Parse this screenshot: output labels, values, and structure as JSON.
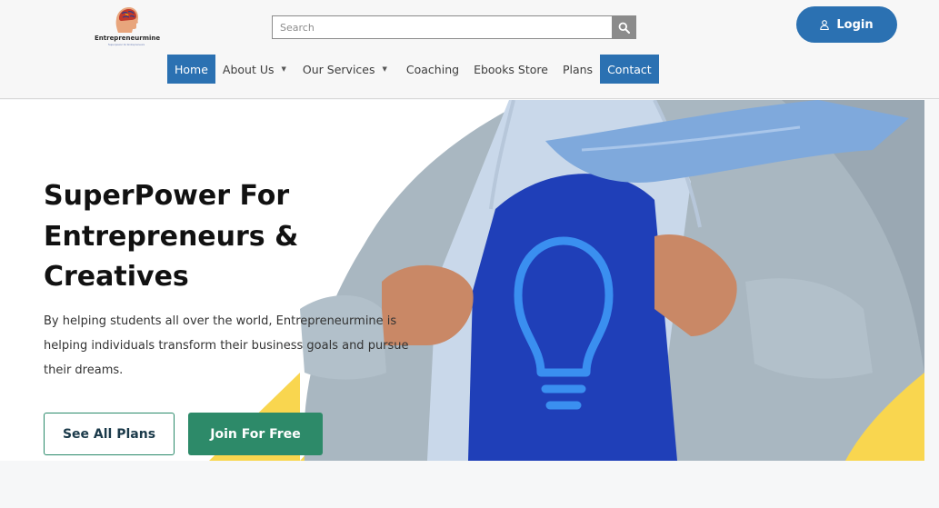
{
  "brand": {
    "name": "Entrepreneurmine",
    "tagline": "Superpower for Entrepreneurs"
  },
  "search": {
    "placeholder": "Search",
    "value": ""
  },
  "login": {
    "label": "Login",
    "icon": "user-icon"
  },
  "nav": {
    "items": [
      {
        "label": "Home",
        "active": true
      },
      {
        "label": "About Us",
        "dropdown": true
      },
      {
        "label": "Our Services",
        "dropdown": true
      },
      {
        "label": "Coaching"
      },
      {
        "label": "Ebooks Store"
      },
      {
        "label": "Plans"
      },
      {
        "label": "Contact",
        "highlight": true
      }
    ]
  },
  "hero": {
    "title": "SuperPower For Entrepreneurs & Creatives",
    "description": "By helping students all over the world, Entrepreneurmine is helping individuals transform their business goals and pursue their dreams.",
    "primary_button": "See All Plans",
    "secondary_button": "Join For Free"
  },
  "colors": {
    "accent_blue": "#2b71b2",
    "accent_green": "#2d8a69",
    "hero_yellow": "#f9d64f"
  }
}
